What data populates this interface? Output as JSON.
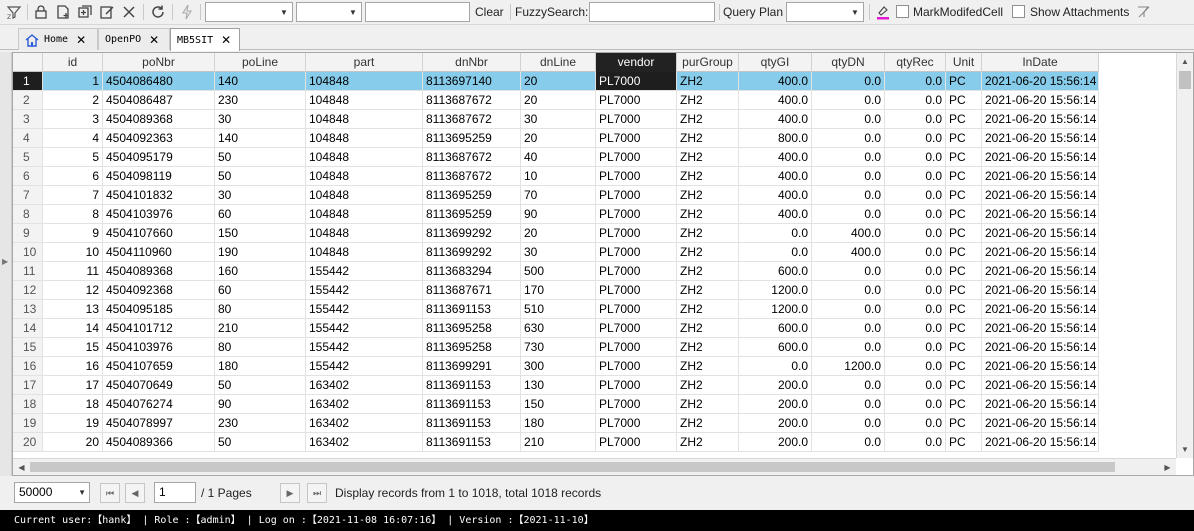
{
  "toolbar": {
    "icons": [
      "filter-clear-icon",
      "lock-icon",
      "new-document-icon",
      "add-icon",
      "edit-icon",
      "close-icon",
      "refresh-icon",
      "lightning-icon"
    ],
    "clear_label": "Clear",
    "fuzzy_search_label": "FuzzySearch:",
    "fuzzy_search_value": "",
    "query_plan_label": "Query Plan",
    "query_plan_value": "",
    "mark_modified_label": "MarkModifedCell",
    "show_attachments_label": "Show Attachments"
  },
  "tabs": [
    {
      "label": "Home",
      "icon": "home-icon",
      "active": false
    },
    {
      "label": "OpenPO",
      "active": false
    },
    {
      "label": "MB5SIT",
      "active": true
    }
  ],
  "grid": {
    "columns": [
      "id",
      "poNbr",
      "poLine",
      "part",
      "dnNbr",
      "dnLine",
      "vendor",
      "purGroup",
      "qtyGI",
      "qtyDN",
      "qtyRec",
      "Unit",
      "InDate"
    ],
    "selected_column": "vendor",
    "selected_row": 1,
    "rows": [
      [
        "1",
        "1",
        "4504086480",
        "140",
        "104848",
        "8113697140",
        "20",
        "PL7000",
        "ZH2",
        "400.0",
        "0.0",
        "0.0",
        "PC",
        "2021-06-20 15:56:14"
      ],
      [
        "2",
        "2",
        "4504086487",
        "230",
        "104848",
        "8113687672",
        "20",
        "PL7000",
        "ZH2",
        "400.0",
        "0.0",
        "0.0",
        "PC",
        "2021-06-20 15:56:14"
      ],
      [
        "3",
        "3",
        "4504089368",
        "30",
        "104848",
        "8113687672",
        "30",
        "PL7000",
        "ZH2",
        "400.0",
        "0.0",
        "0.0",
        "PC",
        "2021-06-20 15:56:14"
      ],
      [
        "4",
        "4",
        "4504092363",
        "140",
        "104848",
        "8113695259",
        "20",
        "PL7000",
        "ZH2",
        "800.0",
        "0.0",
        "0.0",
        "PC",
        "2021-06-20 15:56:14"
      ],
      [
        "5",
        "5",
        "4504095179",
        "50",
        "104848",
        "8113687672",
        "40",
        "PL7000",
        "ZH2",
        "400.0",
        "0.0",
        "0.0",
        "PC",
        "2021-06-20 15:56:14"
      ],
      [
        "6",
        "6",
        "4504098119",
        "50",
        "104848",
        "8113687672",
        "10",
        "PL7000",
        "ZH2",
        "400.0",
        "0.0",
        "0.0",
        "PC",
        "2021-06-20 15:56:14"
      ],
      [
        "7",
        "7",
        "4504101832",
        "30",
        "104848",
        "8113695259",
        "70",
        "PL7000",
        "ZH2",
        "400.0",
        "0.0",
        "0.0",
        "PC",
        "2021-06-20 15:56:14"
      ],
      [
        "8",
        "8",
        "4504103976",
        "60",
        "104848",
        "8113695259",
        "90",
        "PL7000",
        "ZH2",
        "400.0",
        "0.0",
        "0.0",
        "PC",
        "2021-06-20 15:56:14"
      ],
      [
        "9",
        "9",
        "4504107660",
        "150",
        "104848",
        "8113699292",
        "20",
        "PL7000",
        "ZH2",
        "0.0",
        "400.0",
        "0.0",
        "PC",
        "2021-06-20 15:56:14"
      ],
      [
        "10",
        "10",
        "4504110960",
        "190",
        "104848",
        "8113699292",
        "30",
        "PL7000",
        "ZH2",
        "0.0",
        "400.0",
        "0.0",
        "PC",
        "2021-06-20 15:56:14"
      ],
      [
        "11",
        "11",
        "4504089368",
        "160",
        "155442",
        "8113683294",
        "500",
        "PL7000",
        "ZH2",
        "600.0",
        "0.0",
        "0.0",
        "PC",
        "2021-06-20 15:56:14"
      ],
      [
        "12",
        "12",
        "4504092368",
        "60",
        "155442",
        "8113687671",
        "170",
        "PL7000",
        "ZH2",
        "1200.0",
        "0.0",
        "0.0",
        "PC",
        "2021-06-20 15:56:14"
      ],
      [
        "13",
        "13",
        "4504095185",
        "80",
        "155442",
        "8113691153",
        "510",
        "PL7000",
        "ZH2",
        "1200.0",
        "0.0",
        "0.0",
        "PC",
        "2021-06-20 15:56:14"
      ],
      [
        "14",
        "14",
        "4504101712",
        "210",
        "155442",
        "8113695258",
        "630",
        "PL7000",
        "ZH2",
        "600.0",
        "0.0",
        "0.0",
        "PC",
        "2021-06-20 15:56:14"
      ],
      [
        "15",
        "15",
        "4504103976",
        "80",
        "155442",
        "8113695258",
        "730",
        "PL7000",
        "ZH2",
        "600.0",
        "0.0",
        "0.0",
        "PC",
        "2021-06-20 15:56:14"
      ],
      [
        "16",
        "16",
        "4504107659",
        "180",
        "155442",
        "8113699291",
        "300",
        "PL7000",
        "ZH2",
        "0.0",
        "1200.0",
        "0.0",
        "PC",
        "2021-06-20 15:56:14"
      ],
      [
        "17",
        "17",
        "4504070649",
        "50",
        "163402",
        "8113691153",
        "130",
        "PL7000",
        "ZH2",
        "200.0",
        "0.0",
        "0.0",
        "PC",
        "2021-06-20 15:56:14"
      ],
      [
        "18",
        "18",
        "4504076274",
        "90",
        "163402",
        "8113691153",
        "150",
        "PL7000",
        "ZH2",
        "200.0",
        "0.0",
        "0.0",
        "PC",
        "2021-06-20 15:56:14"
      ],
      [
        "19",
        "19",
        "4504078997",
        "230",
        "163402",
        "8113691153",
        "180",
        "PL7000",
        "ZH2",
        "200.0",
        "0.0",
        "0.0",
        "PC",
        "2021-06-20 15:56:14"
      ],
      [
        "20",
        "20",
        "4504089366",
        "50",
        "163402",
        "8113691153",
        "210",
        "PL7000",
        "ZH2",
        "200.0",
        "0.0",
        "0.0",
        "PC",
        "2021-06-20 15:56:14"
      ]
    ]
  },
  "pager": {
    "page_size": "50000",
    "current_page": "1",
    "pages_text": "/ 1 Pages",
    "records_text": "Display records from 1 to 1018, total 1018 records"
  },
  "status": {
    "text": "Current user:【hank】  | Role :【admin】  | Log on :【2021-11-08 16:07:16】  | Version :【2021-11-10】"
  },
  "colors": {
    "selected_row": "#87cdeb",
    "selected_header": "#222222",
    "status_bar": "#000000"
  }
}
